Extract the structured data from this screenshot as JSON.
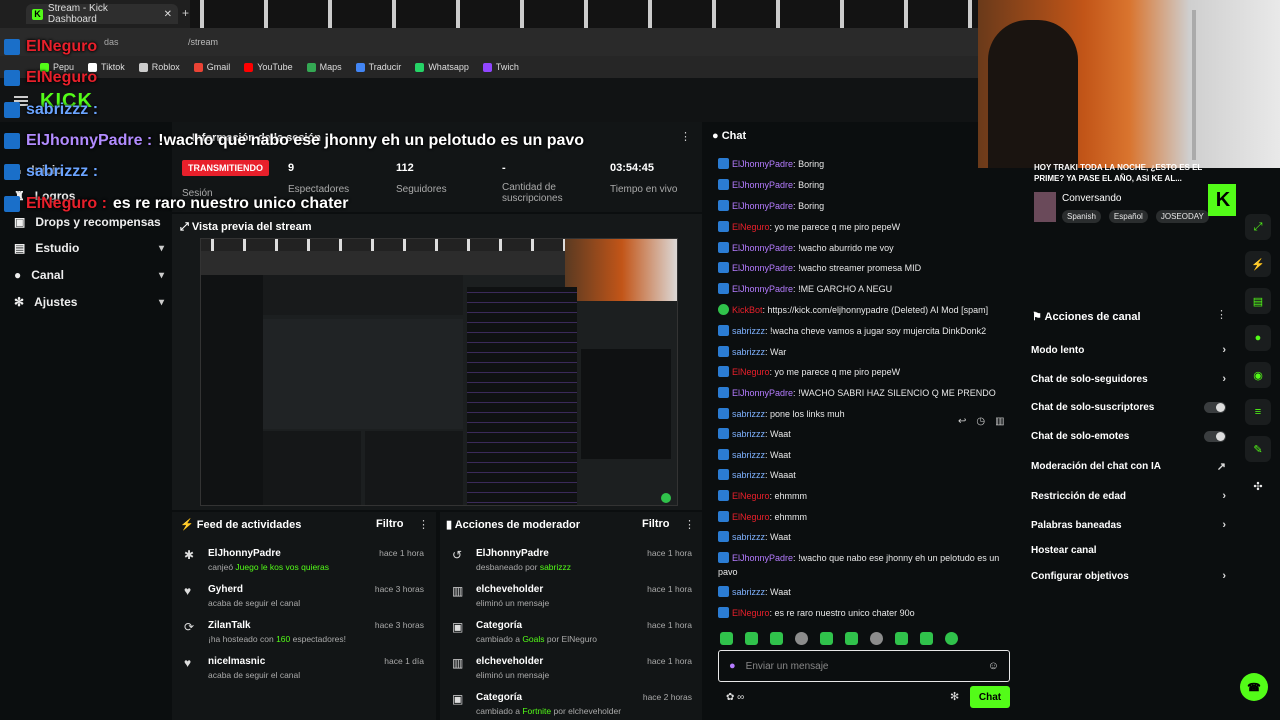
{
  "browser": {
    "tab_title": "Stream - Kick Dashboard",
    "address": "/stream",
    "address_prefix": "das",
    "bookmarks": [
      {
        "label": "Pepu",
        "color": "#53fc18"
      },
      {
        "label": "Tiktok",
        "color": "#ffffff"
      },
      {
        "label": "Roblox",
        "color": "#cccccc"
      },
      {
        "label": "Gmail",
        "color": "#ea4335"
      },
      {
        "label": "YouTube",
        "color": "#ff0000"
      },
      {
        "label": "Maps",
        "color": "#34a853"
      },
      {
        "label": "Traducir",
        "color": "#4285f4"
      },
      {
        "label": "Whatsapp",
        "color": "#25d366"
      },
      {
        "label": "Twich",
        "color": "#9146ff"
      }
    ]
  },
  "brand": "KICK",
  "overlay_chat": [
    {
      "name": "ElNeguro",
      "text": ""
    },
    {
      "name": "ElNeguro",
      "text": ""
    },
    {
      "name": "sabrizzz :",
      "text": ""
    },
    {
      "name": "ElJhonnyPadre :",
      "text": "!wacho que nabo ese jhonny eh un pelotudo es un pavo"
    },
    {
      "name": "sabrizzz :",
      "text": ""
    },
    {
      "name": "ElNeguro :",
      "text": "es re raro nuestro unico chater"
    }
  ],
  "sidebar": {
    "items": [
      {
        "label": "Inicio"
      },
      {
        "label": "Logros"
      },
      {
        "label": "Drops y recompensas"
      },
      {
        "label": "Estudio"
      },
      {
        "label": "Canal"
      },
      {
        "label": "Ajustes"
      }
    ]
  },
  "session": {
    "title": "Información de la sesión",
    "badge": "TRANSMITIENDO",
    "badge_sub": "Sesión",
    "stats": [
      {
        "value": "9",
        "label": "Espectadores"
      },
      {
        "value": "112",
        "label": "Seguidores"
      },
      {
        "value": "-",
        "label": "Cantidad de suscripciones"
      },
      {
        "value": "03:54:45",
        "label": "Tiempo en vivo"
      }
    ]
  },
  "preview": {
    "title": "Vista previa del stream"
  },
  "activity": {
    "title": "Feed de actividades",
    "filter": "Filtro",
    "items": [
      {
        "title": "ElJhonnyPadre",
        "pre": "canjeó ",
        "hl": "Juego le kos vos quieras",
        "post": "",
        "time": "hace 1 hora"
      },
      {
        "title": "Gyherd",
        "pre": "acaba de seguir el canal",
        "hl": "",
        "post": "",
        "time": "hace 3 horas"
      },
      {
        "title": "ZilanTalk",
        "pre": "¡ha hosteado con ",
        "hl": "160",
        "post": " espectadores!",
        "time": "hace 3 horas"
      },
      {
        "title": "nicelmasnic",
        "pre": "acaba de seguir el canal",
        "hl": "",
        "post": "",
        "time": "hace 1 día"
      }
    ]
  },
  "modactions": {
    "title": "Acciones de moderador",
    "filter": "Filtro",
    "items": [
      {
        "title": "ElJhonnyPadre",
        "pre": "desbaneado por ",
        "hl": "sabrizzz",
        "post": "",
        "time": "hace 1 hora"
      },
      {
        "title": "elcheveholder",
        "pre": "eliminó un mensaje",
        "hl": "",
        "post": "",
        "time": "hace 1 hora"
      },
      {
        "title": "Categoría",
        "pre": "cambiado a ",
        "hl": "Goals",
        "post": " por ElNeguro",
        "time": "hace 1 hora"
      },
      {
        "title": "elcheveholder",
        "pre": "eliminó un mensaje",
        "hl": "",
        "post": "",
        "time": "hace 1 hora"
      },
      {
        "title": "Categoría",
        "pre": "cambiado a ",
        "hl": "Fortnite",
        "post": " por elcheveholder",
        "time": "hace 2 horas"
      }
    ]
  },
  "chat": {
    "title": "Chat",
    "messages": [
      {
        "user": "ElJhonnyPadre",
        "cls": "u-green",
        "text": "Boring"
      },
      {
        "user": "ElJhonnyPadre",
        "cls": "u-green",
        "text": "Boring"
      },
      {
        "user": "ElJhonnyPadre",
        "cls": "u-green",
        "text": "Boring"
      },
      {
        "user": "ElNeguro",
        "cls": "u-red",
        "text": "yo me parece q me piro pepeW"
      },
      {
        "user": "ElJhonnyPadre",
        "cls": "u-green",
        "text": "!wacho aburrido me voy"
      },
      {
        "user": "ElJhonnyPadre",
        "cls": "u-green",
        "text": "!wacho streamer promesa MID"
      },
      {
        "user": "ElJhonnyPadre",
        "cls": "u-green",
        "text": "!ME GARCHO A NEGU"
      },
      {
        "user": "KickBot",
        "cls": "u-bot",
        "text": "https://kick.com/eljhonnypadre (Deleted) AI Mod [spam]"
      },
      {
        "user": "sabrizzz",
        "cls": "u-blue",
        "text": "!wacha cheve vamos a jugar soy mujercita DinkDonk2"
      },
      {
        "user": "sabrizzz",
        "cls": "u-blue",
        "text": "War"
      },
      {
        "user": "ElNeguro",
        "cls": "u-red",
        "text": "yo me parece q me piro pepeW"
      },
      {
        "user": "ElJhonnyPadre",
        "cls": "u-green",
        "text": "!WACHO SABRI HAZ SILENCIO Q ME PRENDO"
      },
      {
        "user": "sabrizzz",
        "cls": "u-blue",
        "text": "pone los links muh"
      },
      {
        "user": "sabrizzz",
        "cls": "u-blue",
        "text": "Waat"
      },
      {
        "user": "sabrizzz",
        "cls": "u-blue",
        "text": "Waat"
      },
      {
        "user": "sabrizzz",
        "cls": "u-blue",
        "text": "Waaat"
      },
      {
        "user": "ElNeguro",
        "cls": "u-red",
        "text": "ehmmm"
      },
      {
        "user": "ElNeguro",
        "cls": "u-red",
        "text": "ehmmm"
      },
      {
        "user": "sabrizzz",
        "cls": "u-blue",
        "text": "Waat"
      },
      {
        "user": "ElJhonnyPadre",
        "cls": "u-green",
        "text": "!wacho que nabo ese jhonny eh un pelotudo es un pavo"
      },
      {
        "user": "sabrizzz",
        "cls": "u-blue",
        "text": "Waat"
      },
      {
        "user": "ElNeguro",
        "cls": "u-red",
        "text": "es re raro nuestro unico chater 90o"
      }
    ],
    "input_placeholder": "Enviar un mensaje",
    "send_label": "Chat"
  },
  "stream_info": {
    "headline": "HOY TRAKI TODA LA NOCHE, ¿ESTO ES EL PRIME? YA PASE EL AÑO, ASI KE AL...",
    "status": "Conversando",
    "tags": [
      "Spanish",
      "Español",
      "JOSEODAY"
    ],
    "viewer_badge": "9"
  },
  "channel_actions": {
    "title": "Acciones de canal",
    "items": [
      {
        "label": "Modo lento",
        "kind": "chev"
      },
      {
        "label": "Chat de solo-seguidores",
        "kind": "chev"
      },
      {
        "label": "Chat de solo-suscriptores",
        "kind": "toggle"
      },
      {
        "label": "Chat de solo-emotes",
        "kind": "toggle"
      },
      {
        "label": "Moderación del chat con IA",
        "kind": "link"
      },
      {
        "label": "Restricción de edad",
        "kind": "chev"
      },
      {
        "label": "Palabras baneadas",
        "kind": "chev"
      },
      {
        "label": "Hostear canal",
        "kind": "none"
      },
      {
        "label": "Configurar objetivos",
        "kind": "chev"
      }
    ]
  },
  "colors": {
    "accent": "#53fc18",
    "live": "#e8202b"
  }
}
